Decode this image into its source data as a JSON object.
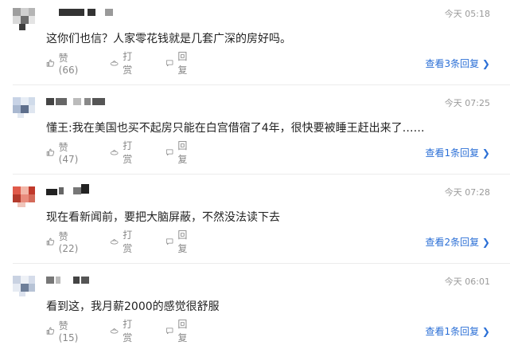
{
  "comments": [
    {
      "time": "今天 05:18",
      "content": "这你们也信？人家零花钱就是几套广深的房好吗。",
      "like_label": "赞(66)",
      "reward_label": "打赏",
      "reply_label": "回复",
      "replies_label": "查看3条回复 ❯"
    },
    {
      "time": "今天 07:25",
      "content": "懂王:我在美国也买不起房只能在白宫借宿了4年，很快要被睡王赶出来了……",
      "like_label": "赞(47)",
      "reward_label": "打赏",
      "reply_label": "回复",
      "replies_label": "查看1条回复 ❯"
    },
    {
      "time": "今天 07:28",
      "content": "现在看新闻前，要把大脑屏蔽，不然没法读下去",
      "like_label": "赞(22)",
      "reward_label": "打赏",
      "reply_label": "回复",
      "replies_label": "查看2条回复 ❯"
    },
    {
      "time": "今天 06:01",
      "content": "看到这，我月薪2000的感觉很舒服",
      "like_label": "赞(15)",
      "reward_label": "打赏",
      "reply_label": "回复",
      "replies_label": "查看1条回复 ❯"
    }
  ],
  "icons": {
    "like": "thumbs-up-icon",
    "reward": "coin-icon",
    "reply": "comment-bubble-icon"
  },
  "colors": {
    "link": "#2b6fd6",
    "meta": "#9a9a9a",
    "divider": "#ececec"
  }
}
